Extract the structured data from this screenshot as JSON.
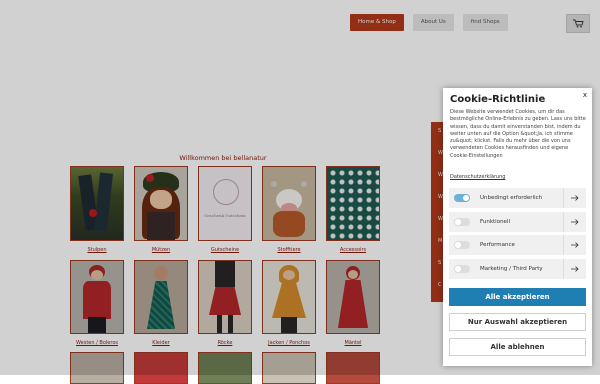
{
  "nav": {
    "items": [
      "Home & Shop",
      "About Us",
      "find Shops"
    ]
  },
  "cart": {
    "icon": "cart-icon"
  },
  "main": {
    "welcome": "Willkommen bei bellanatur",
    "categories": [
      {
        "label": "Stulpen"
      },
      {
        "label": "Mützen"
      },
      {
        "label": "Gutscheine"
      },
      {
        "label": "Stofftiere"
      },
      {
        "label": "Accessoirs"
      },
      {
        "label": "Westen / Boleros"
      },
      {
        "label": "Kleider"
      },
      {
        "label": "Röcke"
      },
      {
        "label": "Jacken / Ponchos"
      },
      {
        "label": "Mäntel"
      }
    ],
    "voucher_text": "Geschenk Gutschein"
  },
  "sidemenu": {
    "items": [
      "S",
      "W",
      "W",
      "W",
      "W",
      "M",
      "S",
      "C"
    ]
  },
  "cookie": {
    "title": "Cookie-Richtlinie",
    "close": "x",
    "text": "Diese Website verwendet Cookies, um dir das bestmögliche Online-Erlebnis zu geben. Lass uns bitte wissen, dass du damit einverstanden bist, indem du weiter unten auf die Option &quot;Ja, ich stimme zu&quot; klickst. Falls du mehr über die von uns verwendeten Cookies herausfinden und eigene Cookie-Einstellungen",
    "link": "Datenschutzerklärung",
    "toggles": [
      {
        "label": "Unbedingt erforderlich",
        "on": true
      },
      {
        "label": "Funktionell",
        "on": false
      },
      {
        "label": "Performance",
        "on": false
      },
      {
        "label": "Marketing / Third Party",
        "on": false
      }
    ],
    "buttons": {
      "accept_all": "Alle akzeptieren",
      "accept_selection": "Nur Auswahl akzeptieren",
      "reject_all": "Alle ablehnen"
    }
  },
  "colors": {
    "brand": "#b2391b",
    "accent": "#1f7fb3",
    "toggle_on": "#6ab1d3"
  }
}
